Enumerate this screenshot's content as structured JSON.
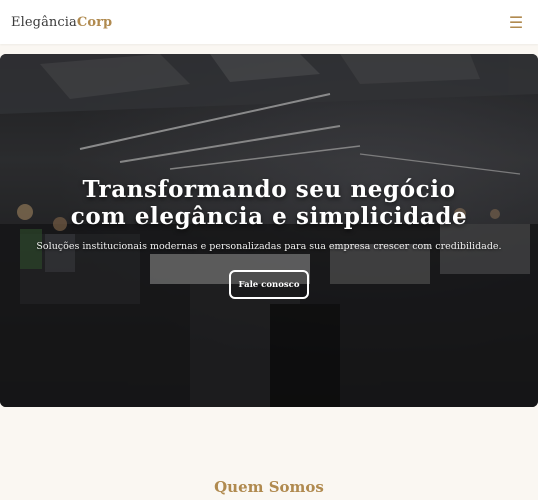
{
  "header": {
    "logo_main": "Elegância",
    "logo_accent": "Corp",
    "menu_icon": "☰"
  },
  "hero": {
    "title_line1": "Transformando seu negócio",
    "title_line2": "com elegância e simplicidade",
    "subtitle": "Soluções institucionais modernas e personalizadas para sua empresa crescer com credibilidade.",
    "cta_label": "Fale conosco"
  },
  "sections": {
    "about_title": "Quem Somos"
  },
  "colors": {
    "accent": "#b08a4f",
    "background": "#faf7f2"
  },
  "icons": {
    "menu": "hamburger-menu-icon"
  }
}
